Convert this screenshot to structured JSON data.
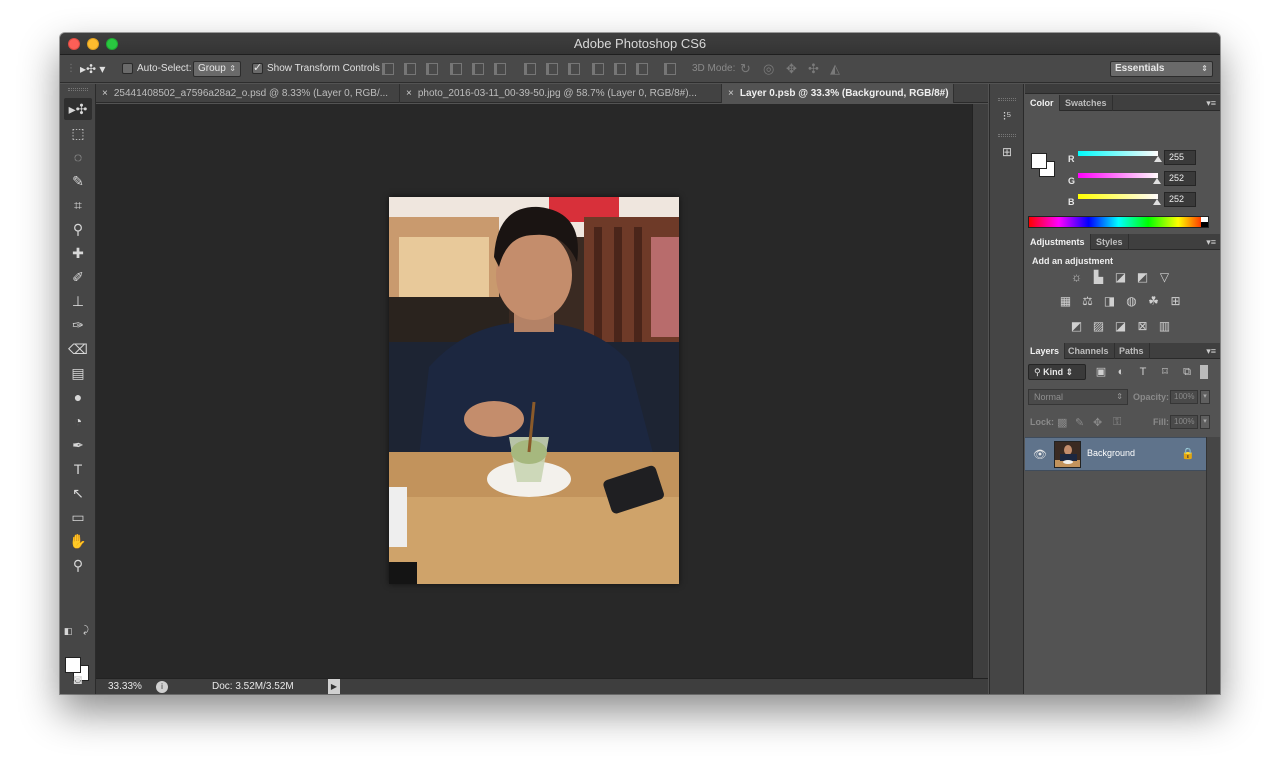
{
  "window": {
    "title": "Adobe Photoshop CS6"
  },
  "options_bar": {
    "auto_select_label": "Auto-Select:",
    "auto_select_value": "Group",
    "show_transform_label": "Show Transform Controls",
    "mode_3d_label": "3D Mode:",
    "workspace": "Essentials"
  },
  "tabs": [
    {
      "label": "25441408502_a7596a28a2_o.psd @ 8.33% (Layer 0, RGB/...",
      "active": false
    },
    {
      "label": "photo_2016-03-11_00-39-50.jpg @ 58.7% (Layer 0, RGB/8#)...",
      "active": false
    },
    {
      "label": "Layer 0.psb @ 33.3% (Background, RGB/8#)",
      "active": true
    }
  ],
  "status": {
    "zoom": "33.33%",
    "doc": "Doc: 3.52M/3.52M"
  },
  "color_panel": {
    "tabs": [
      "Color",
      "Swatches"
    ],
    "channels": [
      {
        "name": "R",
        "value": "255"
      },
      {
        "name": "G",
        "value": "252"
      },
      {
        "name": "B",
        "value": "252"
      }
    ]
  },
  "adjustments_panel": {
    "tabs": [
      "Adjustments",
      "Styles"
    ],
    "title": "Add an adjustment"
  },
  "layers_panel": {
    "tabs": [
      "Layers",
      "Channels",
      "Paths"
    ],
    "kind": "Kind",
    "blend_mode": "Normal",
    "opacity_label": "Opacity:",
    "opacity_value": "100%",
    "lock_label": "Lock:",
    "fill_label": "Fill:",
    "fill_value": "100%",
    "layers": [
      {
        "name": "Background",
        "visible": true,
        "locked": true
      }
    ]
  },
  "colors": {
    "foreground": "#ffffff",
    "background": "#ffffff",
    "selected_layer": "#5f738b"
  }
}
